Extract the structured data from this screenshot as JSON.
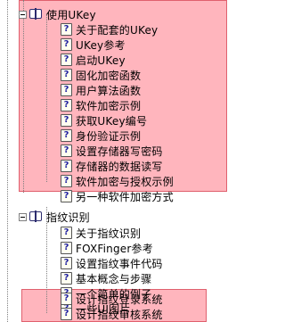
{
  "tree": {
    "group1": {
      "label": "使用UKey",
      "icon": "book-icon",
      "items": [
        {
          "label": "关于配套的UKey",
          "icon": "help-page-icon"
        },
        {
          "label": "UKey参考",
          "icon": "help-page-icon"
        },
        {
          "label": "启动UKey",
          "icon": "help-page-icon"
        },
        {
          "label": "固化加密函数",
          "icon": "help-page-icon"
        },
        {
          "label": "用户算法函数",
          "icon": "help-page-icon"
        },
        {
          "label": "软件加密示例",
          "icon": "help-page-icon"
        },
        {
          "label": "获取UKey编号",
          "icon": "help-page-icon"
        },
        {
          "label": "身份验证示例",
          "icon": "help-page-icon"
        },
        {
          "label": "设置存储器写密码",
          "icon": "help-page-icon"
        },
        {
          "label": "存储器的数据读写",
          "icon": "help-page-icon"
        },
        {
          "label": "软件加密与授权示例",
          "icon": "help-page-icon"
        },
        {
          "label": "另一种软件加密方式",
          "icon": "help-page-icon"
        }
      ]
    },
    "group2": {
      "label": "指纹识别",
      "icon": "book-icon",
      "items": [
        {
          "label": "关于指纹识别",
          "icon": "help-page-icon"
        },
        {
          "label": "FOXFinger参考",
          "icon": "help-page-icon"
        },
        {
          "label": "设置指纹事件代码",
          "icon": "help-page-icon"
        },
        {
          "label": "基本概念与步骤",
          "icon": "help-page-icon"
        },
        {
          "label": "一个简单的例子",
          "icon": "help-page-icon"
        },
        {
          "label": "一些UI图片",
          "icon": "help-page-icon"
        },
        {
          "label": "设计指纹登录系统",
          "icon": "help-page-icon"
        },
        {
          "label": "设计指纹审核系统",
          "icon": "help-page-icon"
        }
      ]
    },
    "help_icon_glyph": "?"
  },
  "colors": {
    "highlight": "#ffa0aa",
    "highlight_border": "#e0606e",
    "icon_glyph": "#2020a0"
  }
}
